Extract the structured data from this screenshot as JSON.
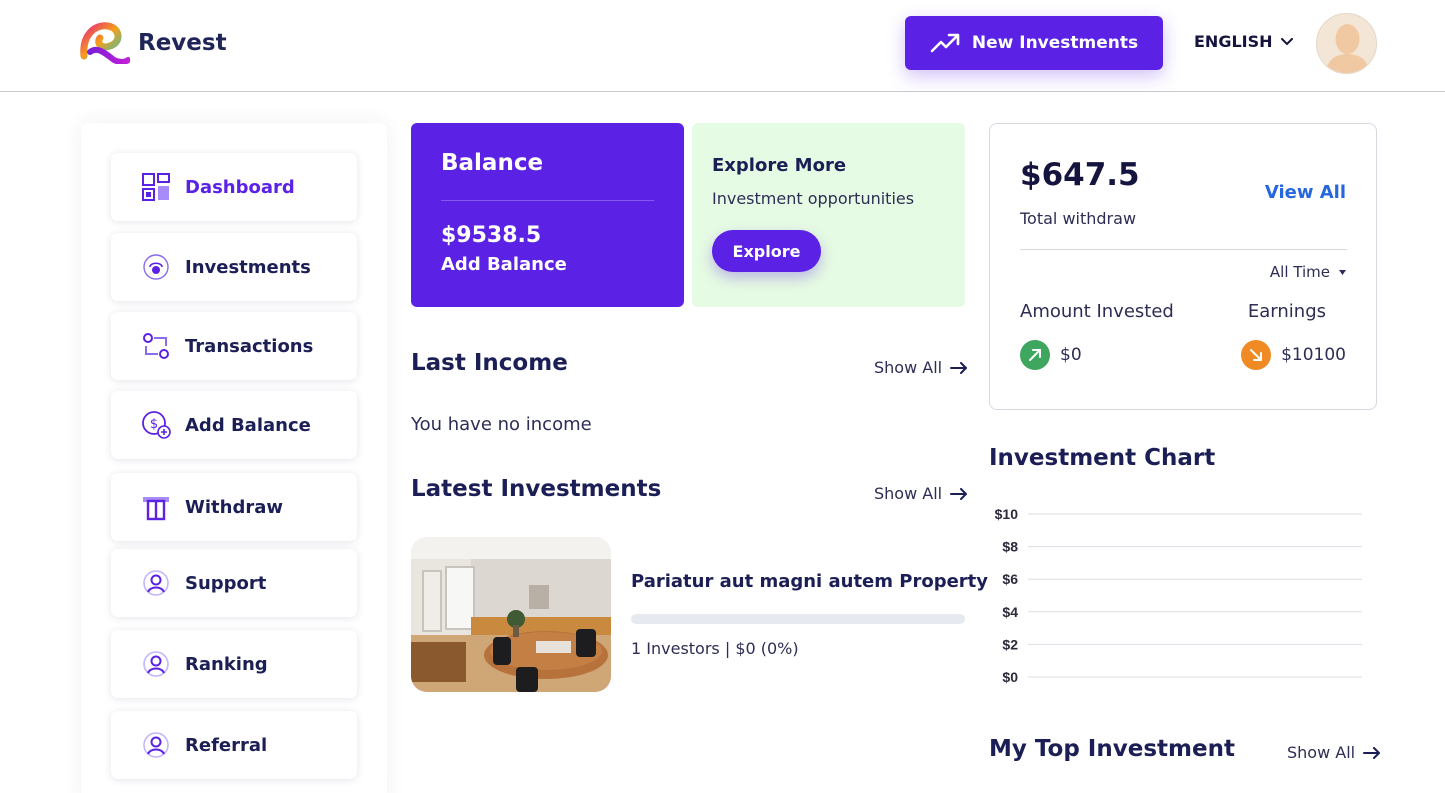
{
  "header": {
    "brand": "Revest",
    "new_investments_label": "New Investments",
    "language": "ENGLISH"
  },
  "sidebar": {
    "items": [
      {
        "label": "Dashboard",
        "icon": "dashboard-icon",
        "active": true
      },
      {
        "label": "Investments",
        "icon": "investments-icon"
      },
      {
        "label": "Transactions",
        "icon": "transactions-icon"
      },
      {
        "label": "Add Balance",
        "icon": "add-balance-icon"
      },
      {
        "label": "Withdraw",
        "icon": "withdraw-icon"
      },
      {
        "label": "Support",
        "icon": "user-icon"
      },
      {
        "label": "Ranking",
        "icon": "user-icon"
      },
      {
        "label": "Referral",
        "icon": "user-icon"
      }
    ]
  },
  "balance": {
    "title": "Balance",
    "amount": "$9538.5",
    "add_label": "Add Balance"
  },
  "explore": {
    "title": "Explore More",
    "subtitle": "Investment opportunities",
    "button": "Explore"
  },
  "last_income": {
    "title": "Last Income",
    "show_all": "Show All",
    "empty": "You have no income"
  },
  "latest_investments": {
    "title": "Latest Investments",
    "show_all": "Show All",
    "items": [
      {
        "name": "Pariatur aut magni autem Property",
        "progress": 0,
        "meta": "1 Investors | $0 (0%)"
      }
    ]
  },
  "withdraw": {
    "amount": "$647.5",
    "label": "Total withdraw",
    "view_all": "View All",
    "filter": "All Time",
    "amount_invested_label": "Amount Invested",
    "amount_invested": "$0",
    "earnings_label": "Earnings",
    "earnings": "$10100"
  },
  "chart_title": "Investment Chart",
  "chart_data": {
    "type": "line",
    "title": "Investment Chart",
    "y_ticks": [
      "$10",
      "$8",
      "$6",
      "$4",
      "$2",
      "$0"
    ],
    "ylim": [
      0,
      10
    ],
    "series": [],
    "grid": true
  },
  "top_investment": {
    "title": "My Top Investment",
    "show_all": "Show All"
  },
  "colors": {
    "primary": "#5b22e6",
    "link": "#2667e0",
    "explore_bg": "#e6fbe3",
    "up": "#3fa65f",
    "down": "#f08a24"
  }
}
